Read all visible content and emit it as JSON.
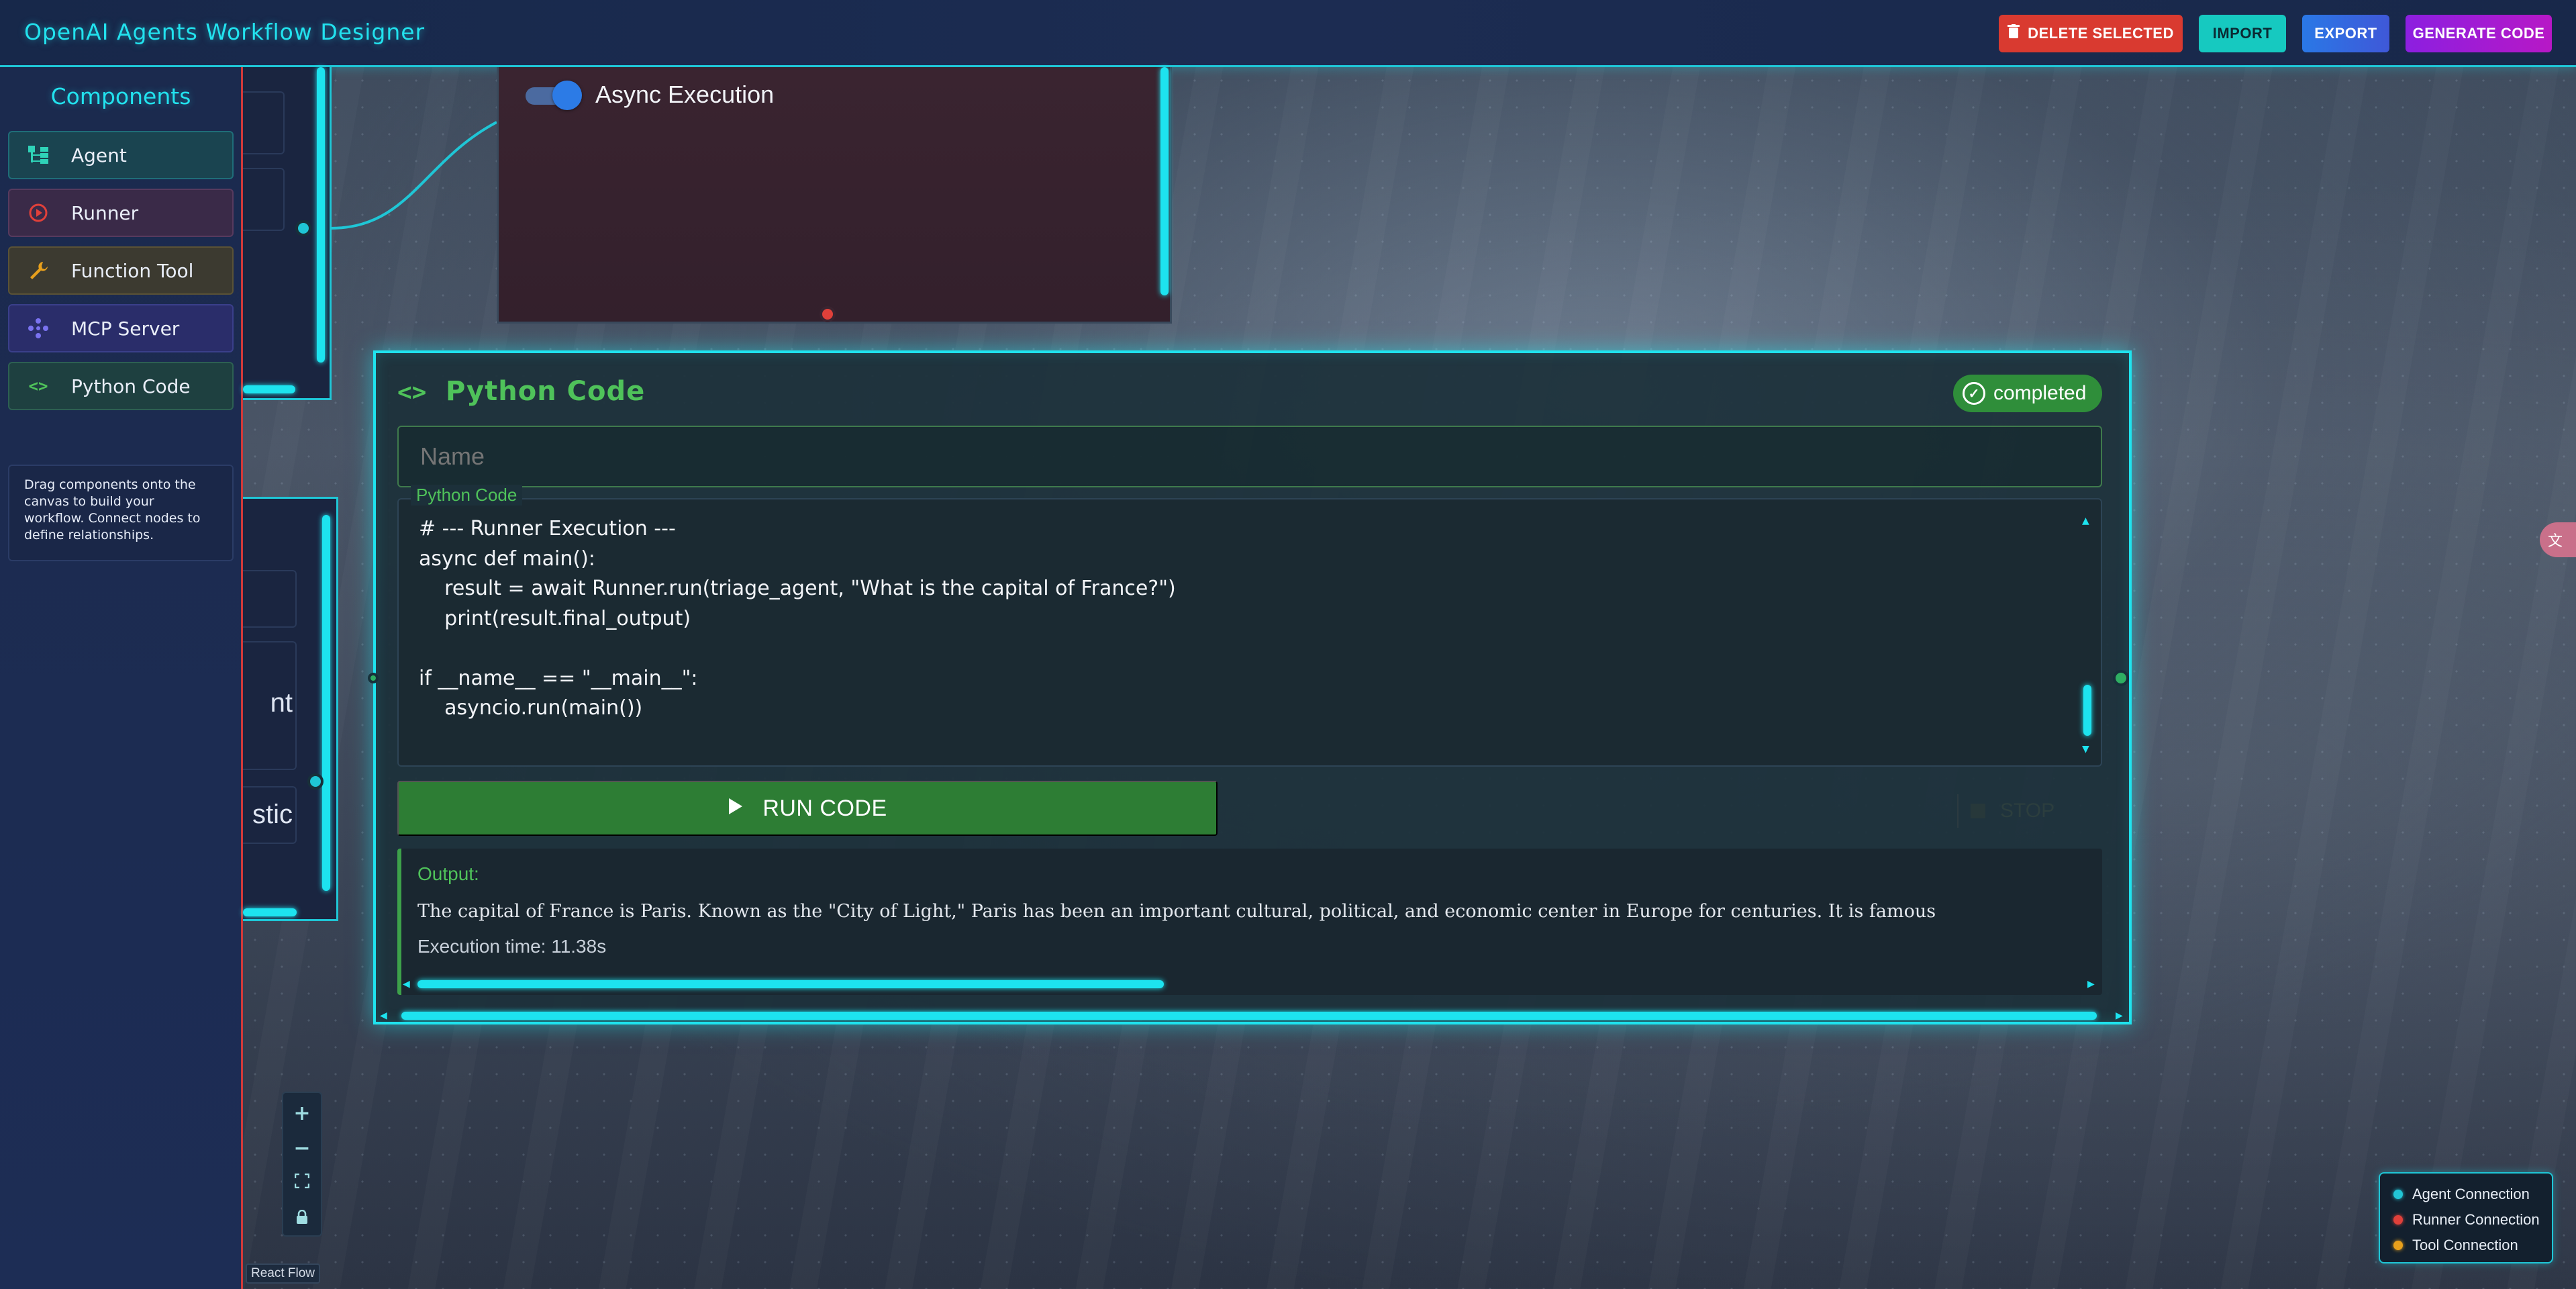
{
  "header": {
    "title": "OpenAI Agents Workflow Designer",
    "delete_label": "DELETE SELECTED",
    "import_label": "IMPORT",
    "export_label": "EXPORT",
    "generate_label": "GENERATE CODE"
  },
  "sidebar": {
    "title": "Components",
    "items": [
      {
        "label": "Agent",
        "icon": "hierarchy-icon"
      },
      {
        "label": "Runner",
        "icon": "play-circle-icon"
      },
      {
        "label": "Function Tool",
        "icon": "wrench-icon"
      },
      {
        "label": "MCP Server",
        "icon": "network-icon"
      },
      {
        "label": "Python Code",
        "icon": "code-icon"
      }
    ],
    "hint": "Drag components onto the canvas to build your workflow. Connect nodes to define relationships."
  },
  "async_node": {
    "toggle_label": "Async Execution",
    "toggle_on": true
  },
  "left_node": {
    "partial_text_1": "nt",
    "partial_text_2": "stic"
  },
  "python_node": {
    "title": "Python Code",
    "status": "completed",
    "name_placeholder": "Name",
    "code_label": "Python Code",
    "code": "# --- Runner Execution ---\nasync def main():\n    result = await Runner.run(triage_agent, \"What is the capital of France?\")\n    print(result.final_output)\n\nif __name__ == \"__main__\":\n    asyncio.run(main())",
    "run_label": "RUN CODE",
    "stop_label": "STOP",
    "output_label": "Output:",
    "output_text": "The capital of France is Paris. Known as the \"City of Light,\" Paris has been an important cultural, political, and economic center in Europe for centuries. It is famous",
    "execution_time": "Execution time: 11.38s"
  },
  "controls": {
    "zoom_in": "+",
    "zoom_out": "−",
    "fit": "⛶",
    "lock": "🔒",
    "attribution": "React Flow"
  },
  "legend": {
    "items": [
      {
        "label": "Agent Connection",
        "color": "#22c6d6"
      },
      {
        "label": "Runner Connection",
        "color": "#e0403a"
      },
      {
        "label": "Tool Connection",
        "color": "#e8a01c"
      }
    ]
  },
  "colors": {
    "accent": "#1fe3ee",
    "code_green": "#4fc25a",
    "delete": "#d93a30"
  }
}
